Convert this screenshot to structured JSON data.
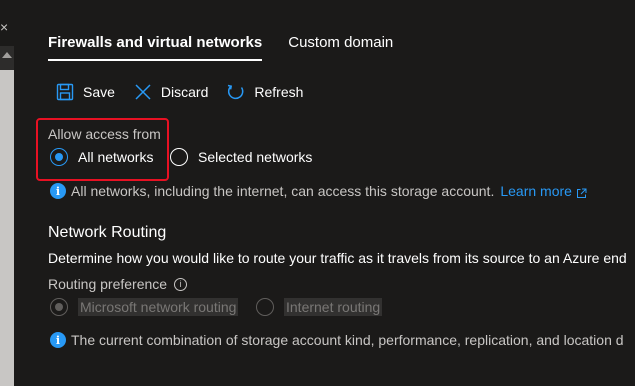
{
  "tabs": [
    {
      "label": "Firewalls and virtual networks",
      "active": true
    },
    {
      "label": "Custom domain",
      "active": false
    }
  ],
  "toolbar": {
    "save_label": "Save",
    "discard_label": "Discard",
    "refresh_label": "Refresh"
  },
  "access": {
    "label": "Allow access from",
    "options": [
      {
        "label": "All networks",
        "selected": true
      },
      {
        "label": "Selected networks",
        "selected": false
      }
    ],
    "info_text": "All networks, including the internet, can access this storage account.",
    "learn_more": "Learn more"
  },
  "routing": {
    "title": "Network Routing",
    "description": "Determine how you would like to route your traffic as it travels from its source to an Azure end",
    "preference_label": "Routing preference",
    "options": [
      {
        "label": "Microsoft network routing",
        "selected": true,
        "disabled": true
      },
      {
        "label": "Internet routing",
        "selected": false,
        "disabled": true
      }
    ],
    "info_text": "The current combination of storage account kind, performance, replication, and location d"
  },
  "colors": {
    "accent": "#2899f5",
    "highlight_border": "#e81123",
    "background": "#1b1a19"
  },
  "icons": {
    "save": "save-icon",
    "discard": "discard-icon",
    "refresh": "refresh-icon",
    "info": "info-icon",
    "external": "external-link-icon",
    "close": "close-icon"
  }
}
